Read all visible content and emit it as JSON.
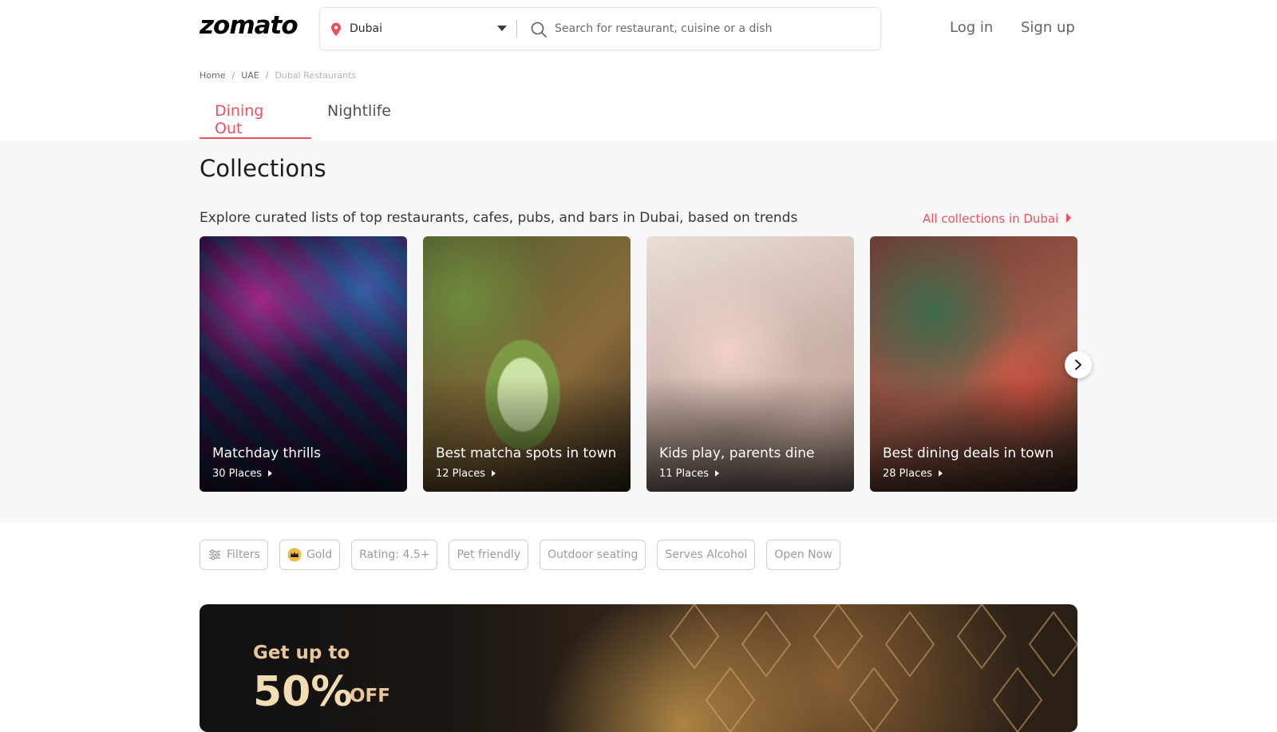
{
  "header": {
    "logo": "zomato",
    "location": "Dubai",
    "search_placeholder": "Search for restaurant, cuisine or a dish",
    "login": "Log in",
    "signup": "Sign up"
  },
  "breadcrumb": [
    "Home",
    "UAE",
    "Dubai Restaurants"
  ],
  "tabs": [
    {
      "label": "Dining Out",
      "active": true
    },
    {
      "label": "Nightlife",
      "active": false
    }
  ],
  "collections": {
    "title": "Collections",
    "description": "Explore curated lists of top restaurants, cafes, pubs, and bars in Dubai, based on trends",
    "all_link": "All collections in Dubai",
    "cards": [
      {
        "title": "Matchday thrills",
        "places": "30 Places"
      },
      {
        "title": "Best matcha spots in town",
        "places": "12 Places"
      },
      {
        "title": "Kids play, parents dine",
        "places": "11 Places"
      },
      {
        "title": "Best dining deals in town",
        "places": "28 Places"
      }
    ]
  },
  "filters": [
    "Filters",
    "Gold",
    "Rating: 4.5+",
    "Pet friendly",
    "Outdoor seating",
    "Serves Alcohol",
    "Open Now"
  ],
  "promo": {
    "line1": "Get up to",
    "percent": "50%",
    "off": "OFF"
  },
  "colors": {
    "accent": "#ef4f5f",
    "section_bg": "#f8f8f8"
  },
  "icons": {
    "location": "location-pin-icon",
    "dropdown": "caret-down-icon",
    "search": "search-icon",
    "next": "chevron-right-icon",
    "filters": "sliders-icon",
    "gold": "crown-badge-icon"
  }
}
